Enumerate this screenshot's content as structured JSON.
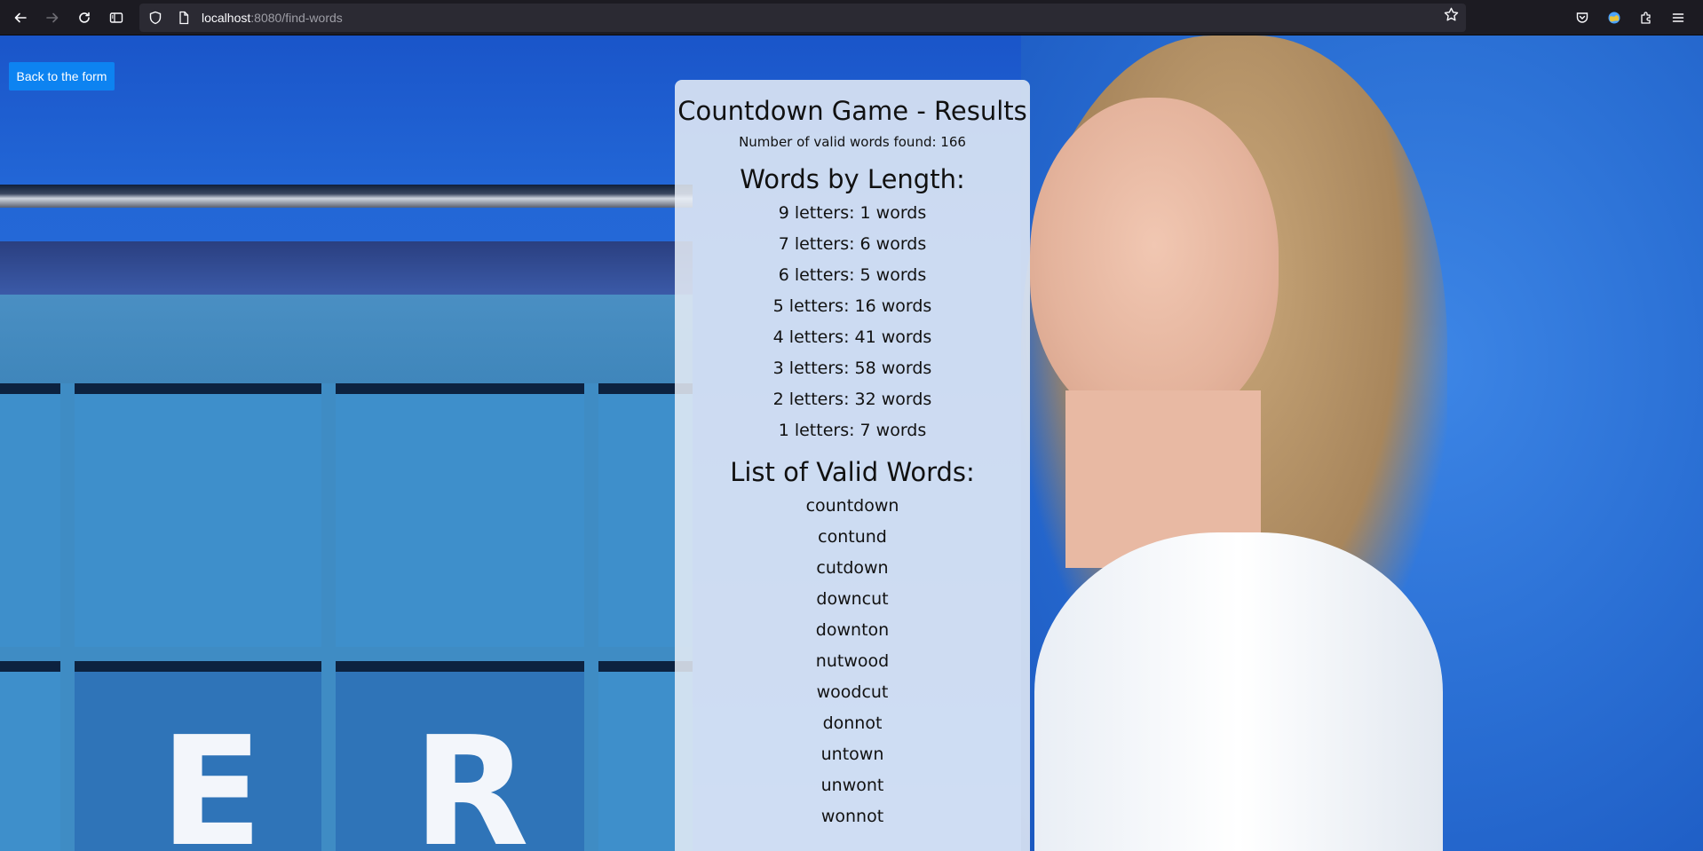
{
  "browser": {
    "url_host": "localhost",
    "url_path": ":8080/find-words"
  },
  "back_button": {
    "label": "Back to the form"
  },
  "results": {
    "title": "Countdown Game - Results",
    "valid_count_text": "Number of valid words found: 166",
    "by_length_heading": "Words by Length:",
    "by_length": [
      "9 letters: 1 words",
      "7 letters: 6 words",
      "6 letters: 5 words",
      "5 letters: 16 words",
      "4 letters: 41 words",
      "3 letters: 58 words",
      "2 letters: 32 words",
      "1 letters: 7 words"
    ],
    "list_heading": "List of Valid Words:",
    "words": [
      "countdown",
      "contund",
      "cutdown",
      "downcut",
      "downton",
      "nutwood",
      "woodcut",
      "donnot",
      "untown",
      "unwont",
      "wonnot"
    ]
  },
  "background": {
    "tile_letters": [
      "E",
      "R"
    ]
  },
  "icons": {
    "back": "arrow-left-icon",
    "forward": "arrow-right-icon",
    "reload": "reload-icon",
    "sidebar": "sidebar-icon",
    "tracking": "shield-icon",
    "page": "page-icon",
    "bookmark": "star-icon",
    "pocket": "pocket-icon",
    "account": "account-icon",
    "extensions": "puzzle-icon",
    "menu": "hamburger-menu-icon"
  }
}
